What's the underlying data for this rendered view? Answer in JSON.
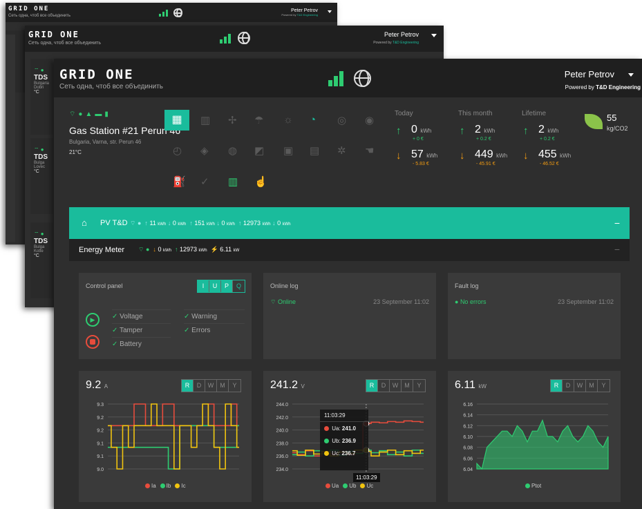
{
  "app": {
    "logo": "GRID ONE",
    "tagline": "Сеть одна, чтоб все объединить"
  },
  "user": {
    "name": "Peter Petrov",
    "powered_prefix": "Powered by",
    "powered_brand": "T&D Engineering"
  },
  "sidebar_cards": [
    {
      "title": "TDS",
      "sub": "Bulgaria",
      "sub2": "Dobri",
      "temp": "°C"
    },
    {
      "title": "TDS",
      "sub": "Bulga",
      "sub2": "Lovec",
      "temp": "°C"
    },
    {
      "title": "TDS",
      "sub": "Bulga",
      "sub2": "Kotle",
      "temp": "°C"
    }
  ],
  "site": {
    "name": "Gas Station #21 Perun 46",
    "address": "Bulgaria, Varna, str. Perun 46",
    "temp": "21°C"
  },
  "stats": {
    "today": {
      "label": "Today",
      "in_val": "0",
      "in_cost": "+ 0 €",
      "out_val": "57",
      "out_cost": "- 5.83 €"
    },
    "month": {
      "label": "This month",
      "in_val": "2",
      "in_cost": "+ 0.2 €",
      "out_val": "449",
      "out_cost": "- 45.91 €"
    },
    "lifetime": {
      "label": "Lifetime",
      "in_val": "2",
      "in_cost": "+ 0.2 €",
      "out_val": "455",
      "out_cost": "- 46.52 €"
    },
    "unit": "kWh",
    "co2_value": "55",
    "co2_unit": "kg/CO2"
  },
  "pv": {
    "title": "PV T&D",
    "v1": "11",
    "v2": "0",
    "v3": "151",
    "v4": "0",
    "v5": "12973",
    "v6": "0",
    "unit": "kWh"
  },
  "meter": {
    "title": "Energy Meter",
    "down": "0",
    "up": "12973",
    "power": "6.11",
    "unit": "kWh",
    "punit": "kW"
  },
  "control": {
    "title": "Control panel",
    "modes": [
      "I",
      "U",
      "P",
      "Q"
    ],
    "checks_left": [
      "Voltage",
      "Tamper",
      "Battery"
    ],
    "checks_right": [
      "Warning",
      "Errors"
    ]
  },
  "online_log": {
    "title": "Online log",
    "status": "Online",
    "time": "23 September 11:02"
  },
  "fault_log": {
    "title": "Fault log",
    "status": "No errors",
    "time": "23 September 11:02"
  },
  "range_buttons": [
    "R",
    "D",
    "W",
    "M",
    "Y"
  ],
  "charts": {
    "current": {
      "value": "9.2",
      "unit": "A"
    },
    "voltage": {
      "value": "241.2",
      "unit": "V"
    },
    "power": {
      "value": "6.11",
      "unit": "kW"
    },
    "tooltip": {
      "time": "11:03:29",
      "rows": [
        {
          "label": "Ua",
          "value": "241.0"
        },
        {
          "label": "Ub",
          "value": "236.9"
        },
        {
          "label": "Uc",
          "value": "236.7"
        }
      ],
      "cursor_label": "11:03:29"
    }
  },
  "chart_data": [
    {
      "type": "line",
      "ylim": [
        9.0,
        9.3
      ],
      "yticks": [
        "9.3",
        "9.2",
        "9.2",
        "9.1",
        "9.1",
        "9.0"
      ],
      "series": [
        {
          "name": "Ia",
          "color": "#e74c3c",
          "values": [
            9.2,
            9.2,
            9.2,
            9.2,
            9.2,
            9.3,
            9.3,
            9.2,
            9.2,
            9.2,
            9.3,
            9.3,
            9.2,
            9.2,
            9.2,
            9.2,
            9.2,
            9.2,
            9.3,
            9.2,
            9.2,
            9.2,
            9.3,
            9.2
          ]
        },
        {
          "name": "Ib",
          "color": "#2ecc71",
          "values": [
            9.1,
            9.1,
            9.1,
            9.1,
            9.1,
            9.1,
            9.1,
            9.1,
            9.1,
            9.1,
            9.1,
            9.0,
            9.0,
            9.2,
            9.2,
            9.2,
            9.2,
            9.2,
            9.2,
            9.1,
            9.1,
            9.1,
            9.1,
            9.2
          ]
        },
        {
          "name": "Ic",
          "color": "#f1c40f",
          "values": [
            9.2,
            9.1,
            9.0,
            9.2,
            9.1,
            9.2,
            9.2,
            9.2,
            9.3,
            9.2,
            9.2,
            9.2,
            9.0,
            9.2,
            9.2,
            9.1,
            9.2,
            9.3,
            9.2,
            9.1,
            9.0,
            9.3,
            9.2,
            9.1
          ]
        }
      ]
    },
    {
      "type": "line",
      "ylim": [
        234,
        244
      ],
      "yticks": [
        "244.0",
        "242.0",
        "240.0",
        "238.0",
        "236.0",
        "234.0"
      ],
      "series": [
        {
          "name": "Ua",
          "color": "#e74c3c",
          "values": [
            236.5,
            236.2,
            236.8,
            236.0,
            236.4,
            236.3,
            236.6,
            236.2,
            236.5,
            241.0,
            241.2,
            241.1,
            241.3,
            241.2,
            241.4,
            241.3,
            241.2
          ]
        },
        {
          "name": "Ub",
          "color": "#2ecc71",
          "values": [
            236.2,
            236.6,
            236.0,
            236.8,
            236.3,
            236.9,
            236.1,
            236.7,
            236.4,
            236.9,
            236.5,
            236.8,
            236.2,
            236.6,
            236.0,
            236.9,
            236.4
          ]
        },
        {
          "name": "Uc",
          "color": "#f1c40f",
          "values": [
            236.8,
            236.1,
            236.9,
            236.3,
            236.7,
            236.0,
            236.6,
            236.4,
            236.9,
            236.7,
            236.0,
            236.6,
            236.9,
            236.2,
            236.8,
            236.4,
            236.9
          ]
        }
      ]
    },
    {
      "type": "area",
      "ylim": [
        6.04,
        6.16
      ],
      "yticks": [
        "6.16",
        "6.14",
        "6.12",
        "6.10",
        "6.08",
        "6.06",
        "6.04"
      ],
      "series": [
        {
          "name": "Ptot",
          "color": "#2ecc71",
          "values": [
            6.05,
            6.04,
            6.08,
            6.09,
            6.1,
            6.11,
            6.11,
            6.1,
            6.12,
            6.11,
            6.09,
            6.11,
            6.11,
            6.13,
            6.1,
            6.1,
            6.09,
            6.11,
            6.12,
            6.1,
            6.09,
            6.1,
            6.12,
            6.11,
            6.09,
            6.08,
            6.1
          ]
        }
      ]
    }
  ]
}
